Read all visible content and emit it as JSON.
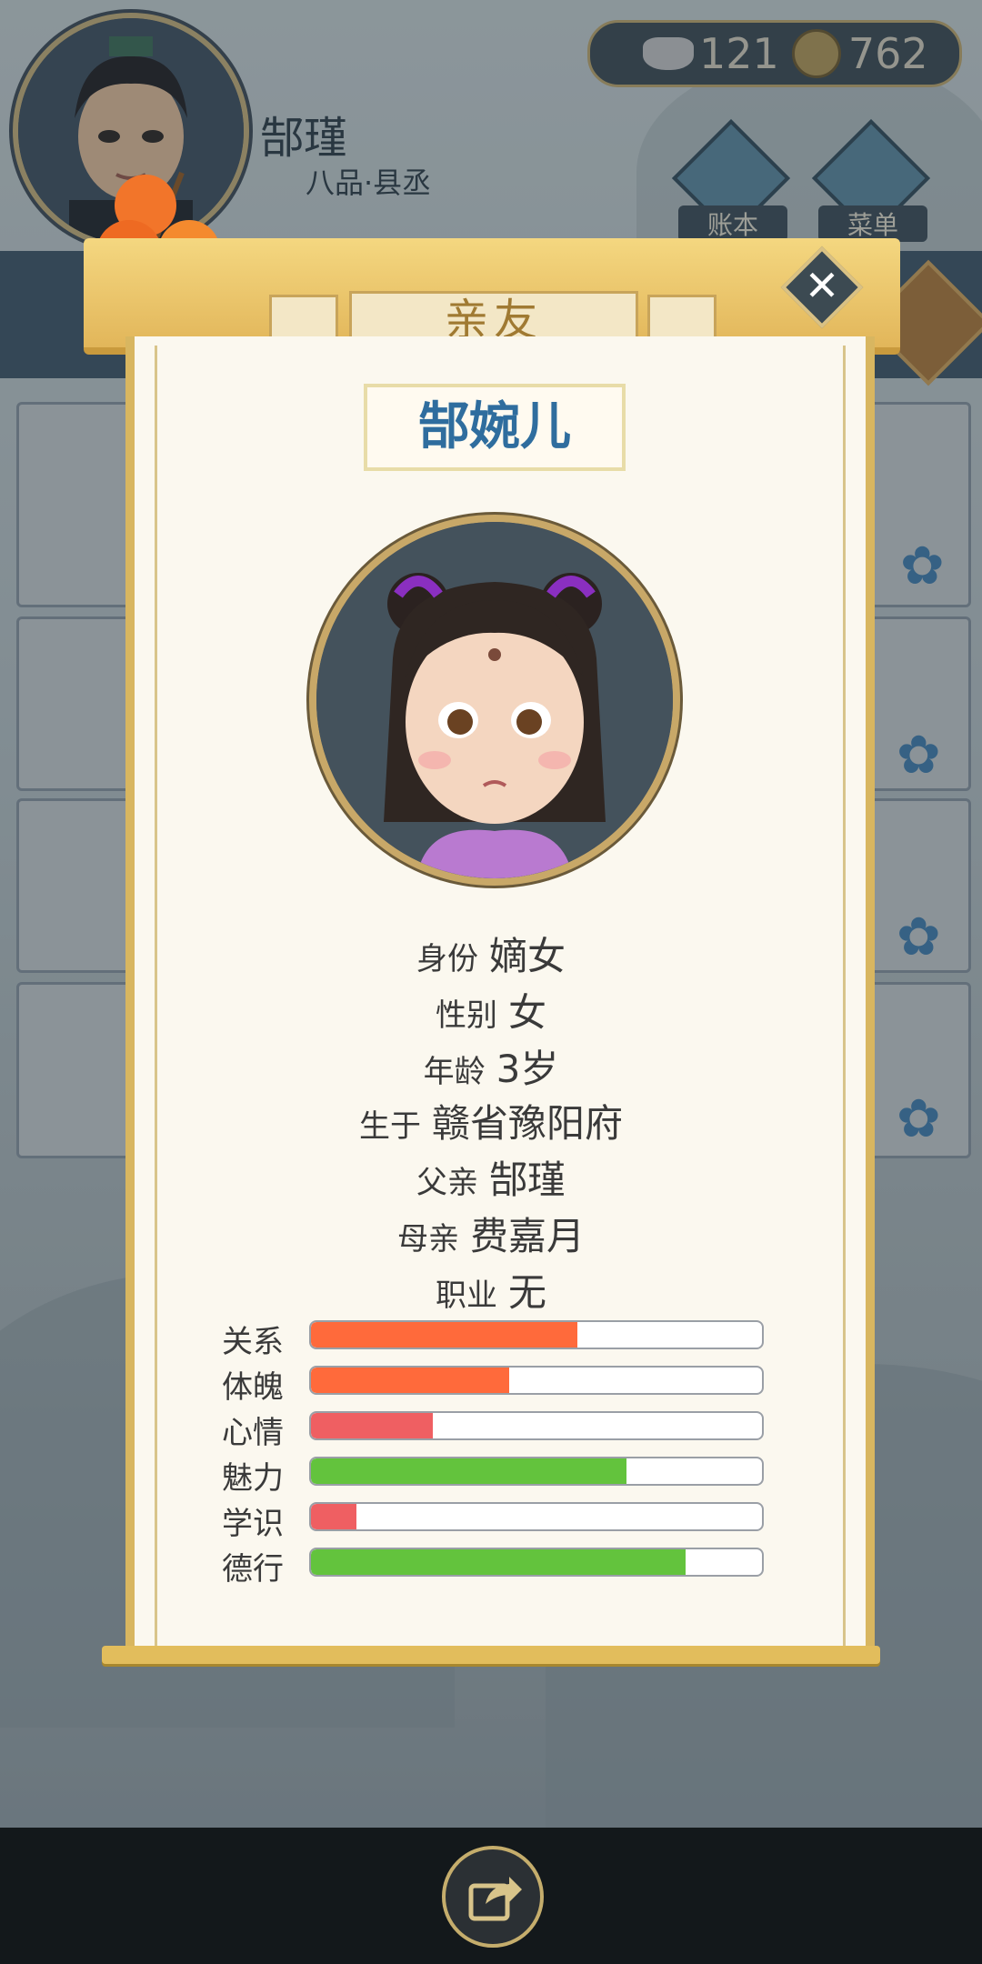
{
  "header": {
    "player_name": "郜瑾",
    "player_rank": "八品·县丞",
    "silver": "121",
    "coins": "762",
    "ledger_label": "账本",
    "menu_label": "菜单"
  },
  "popup": {
    "tab_title": "亲友",
    "close_symbol": "✕",
    "person_name": "郜婉儿",
    "info": [
      {
        "key": "身份",
        "value": "嫡女"
      },
      {
        "key": "性别",
        "value": "女"
      },
      {
        "key": "年龄",
        "value": "3岁"
      },
      {
        "key": "生于",
        "value": "赣省豫阳府"
      },
      {
        "key": "父亲",
        "value": "郜瑾"
      },
      {
        "key": "母亲",
        "value": "费嘉月"
      },
      {
        "key": "职业",
        "value": "无"
      }
    ],
    "stats": [
      {
        "label": "关系",
        "fraction": 0.59,
        "color": "#ff6a3b"
      },
      {
        "label": "体魄",
        "fraction": 0.44,
        "color": "#ff6a3b"
      },
      {
        "label": "心情",
        "fraction": 0.27,
        "color": "#ef5f62"
      },
      {
        "label": "魅力",
        "fraction": 0.7,
        "color": "#63c33d"
      },
      {
        "label": "学识",
        "fraction": 0.1,
        "color": "#ef5f62"
      },
      {
        "label": "德行",
        "fraction": 0.83,
        "color": "#63c33d"
      }
    ]
  },
  "footer": {
    "share_icon": "share-icon"
  }
}
